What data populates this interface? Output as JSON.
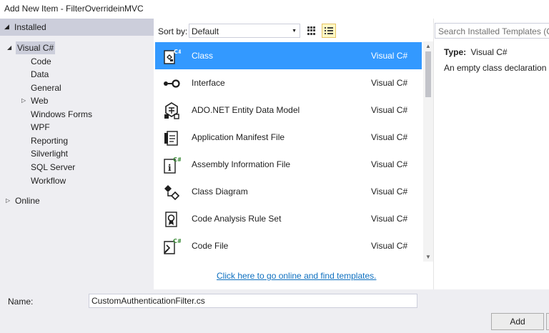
{
  "window": {
    "title": "Add New Item - FilterOverrideinMVC"
  },
  "sidebar": {
    "installed": "Installed",
    "visual_csharp": "Visual C#",
    "items": [
      {
        "label": "Code"
      },
      {
        "label": "Data"
      },
      {
        "label": "General"
      },
      {
        "label": "Web"
      },
      {
        "label": "Windows Forms"
      },
      {
        "label": "WPF"
      },
      {
        "label": "Reporting"
      },
      {
        "label": "Silverlight"
      },
      {
        "label": "SQL Server"
      },
      {
        "label": "Workflow"
      }
    ],
    "online": "Online"
  },
  "toolbar": {
    "sort_by_label": "Sort by:",
    "sort_value": "Default"
  },
  "templates": [
    {
      "name": "Class",
      "lang": "Visual C#",
      "icon": "class-file-icon"
    },
    {
      "name": "Interface",
      "lang": "Visual C#",
      "icon": "interface-icon"
    },
    {
      "name": "ADO.NET Entity Data Model",
      "lang": "Visual C#",
      "icon": "entity-model-icon"
    },
    {
      "name": "Application Manifest File",
      "lang": "Visual C#",
      "icon": "manifest-icon"
    },
    {
      "name": "Assembly Information File",
      "lang": "Visual C#",
      "icon": "assembly-info-icon"
    },
    {
      "name": "Class Diagram",
      "lang": "Visual C#",
      "icon": "class-diagram-icon"
    },
    {
      "name": "Code Analysis Rule Set",
      "lang": "Visual C#",
      "icon": "rule-set-icon"
    },
    {
      "name": "Code File",
      "lang": "Visual C#",
      "icon": "code-file-icon"
    }
  ],
  "online_link": "Click here to go online and find templates.",
  "details": {
    "search_placeholder": "Search Installed Templates (Ctrl+E)",
    "type_label": "Type:",
    "type_value": "Visual C#",
    "description": "An empty class declaration"
  },
  "bottom": {
    "name_label": "Name:",
    "name_value": "CustomAuthenticationFilter.cs",
    "add_label": "Add"
  },
  "colors": {
    "selection": "#3399ff",
    "pane_bg": "#eeeef2",
    "header_bg": "#cccedb",
    "link": "#0e70c0"
  }
}
